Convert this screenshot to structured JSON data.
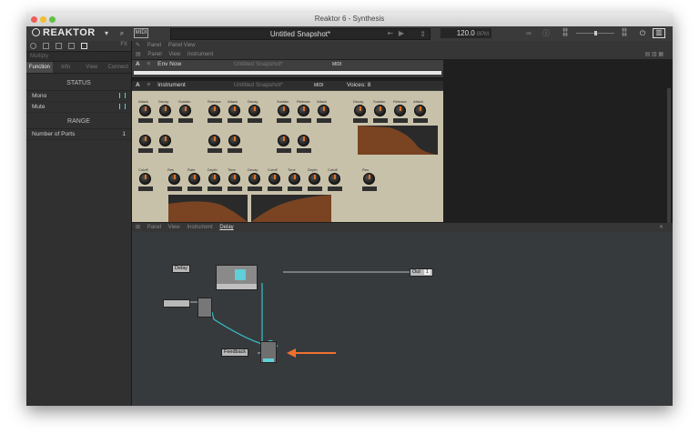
{
  "window": {
    "title": "Reaktor 6 - Synthesis"
  },
  "toolbar": {
    "logo": "REAKTOR",
    "midi_label": "MIDI",
    "snapshot": "Untitled Snapshot*",
    "tempo": "120.0",
    "tempo_unit": "BPM",
    "icons": [
      "search-icon",
      "midi-icon",
      "snapshot-arrows-icon",
      "transport-icon",
      "play-icon",
      "tempo-icon",
      "link-icon",
      "info-icon",
      "cpu-icon",
      "volume-icon",
      "audio-icon",
      "power-icon",
      "panel-toggle-icon"
    ]
  },
  "sidebar": {
    "search_placeholder": "Multiply",
    "tabs": [
      "Function",
      "Info",
      "View",
      "Connect"
    ],
    "status_header": "STATUS",
    "status_rows": [
      {
        "label": "Mono"
      },
      {
        "label": "Mute"
      }
    ],
    "range_header": "RANGE",
    "range_rows": [
      {
        "label": "Number of Ports",
        "value": "1"
      }
    ]
  },
  "top_breadcrumb": [
    "Panel",
    "Panel View"
  ],
  "panel_breadcrumb": [
    "Panel",
    "View",
    "Instrument"
  ],
  "instruments": [
    {
      "tag": "A",
      "name": "Env Now",
      "snapshot": "Untitled Snapshot*",
      "midi": "MIDI"
    },
    {
      "tag": "A",
      "name": "Instrument",
      "snapshot": "Untitled Snapshot*",
      "midi": "MIDI",
      "voices": "Voices: 8"
    }
  ],
  "knob_labels": {
    "row1": [
      "Attack",
      "Decay",
      "Sustain",
      "Release",
      "Attack",
      "Decay",
      "Sustain",
      "Release"
    ],
    "row3": [
      "Cutoff",
      "Res",
      "Rate",
      "Depth",
      "Time",
      "Decay",
      "Cutoff",
      "Tone",
      "Depth"
    ]
  },
  "structure_breadcrumb": [
    "Panel",
    "View",
    "Instrument",
    "Delay"
  ],
  "structure": {
    "modules": [
      "Delay",
      "Out",
      "Feedback"
    ],
    "port_out": "1"
  },
  "colors": {
    "wire": "#36c0c8",
    "arrow": "#f07030",
    "panel": "#c8c1aa"
  }
}
